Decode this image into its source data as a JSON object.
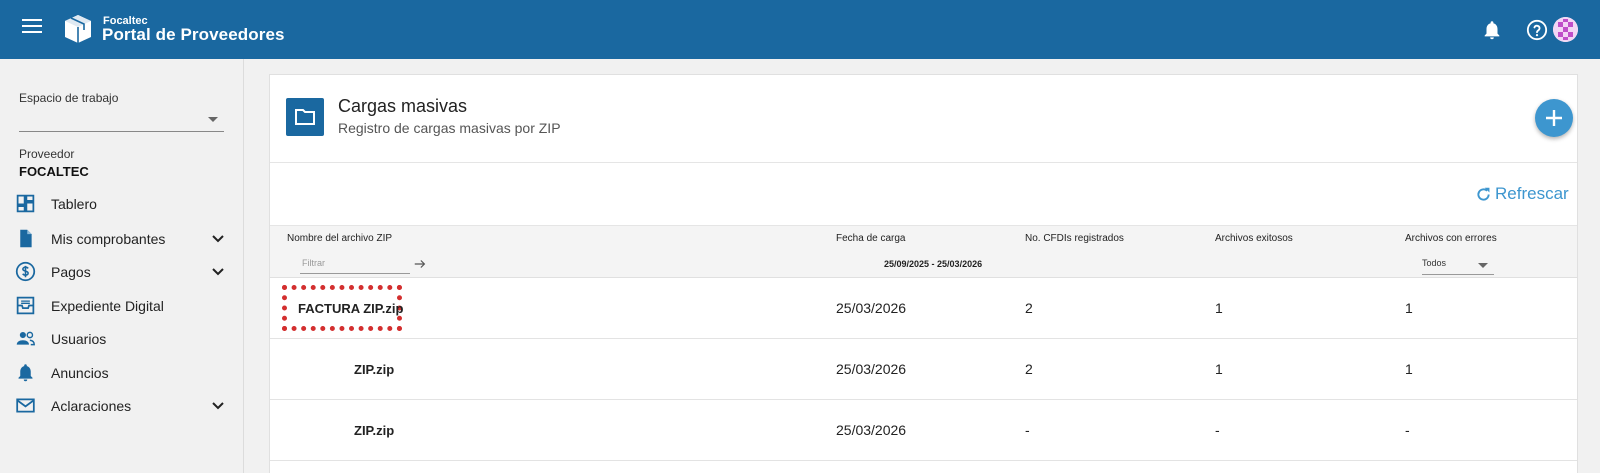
{
  "header": {
    "brand_small": "Focaltec",
    "brand_main": "Portal de Proveedores",
    "colors": {
      "primary": "#1a68a0",
      "accent": "#3d96cf"
    },
    "icons": [
      "menu-icon",
      "cube-logo-icon",
      "bell-icon",
      "help-icon",
      "avatar"
    ]
  },
  "sidebar": {
    "workspace_label": "Espacio de trabajo",
    "workspace_value": "",
    "provider_label": "Proveedor",
    "provider_value": "FOCALTEC",
    "items": [
      {
        "label": "Tablero",
        "icon": "dashboard-icon",
        "expandable": false
      },
      {
        "label": "Mis comprobantes",
        "icon": "document-icon",
        "expandable": true
      },
      {
        "label": "Pagos",
        "icon": "dollar-circle-icon",
        "expandable": true
      },
      {
        "label": "Expediente Digital",
        "icon": "inbox-tray-icon",
        "expandable": false
      },
      {
        "label": "Usuarios",
        "icon": "users-icon",
        "expandable": false
      },
      {
        "label": "Anuncios",
        "icon": "bell-icon",
        "expandable": false
      },
      {
        "label": "Aclaraciones",
        "icon": "mail-icon",
        "expandable": true
      }
    ]
  },
  "main": {
    "title": "Cargas masivas",
    "subtitle": "Registro de cargas masivas por ZIP",
    "refresh_label": "Refrescar",
    "table": {
      "columns": [
        "Nombre del archivo ZIP",
        "Fecha de carga",
        "No. CFDIs registrados",
        "Archivos exitosos",
        "Archivos con errores"
      ],
      "filter_placeholder": "Filtrar",
      "date_range": "25/09/2025 - 25/03/2026",
      "status_filter": "Todos",
      "rows": [
        {
          "name": "FACTURA ZIP.zip",
          "date": "25/03/2026",
          "cfdis": "2",
          "ok": "1",
          "errors": "1"
        },
        {
          "name": "ZIP.zip",
          "date": "25/03/2026",
          "cfdis": "2",
          "ok": "1",
          "errors": "1"
        },
        {
          "name": "ZIP.zip",
          "date": "25/03/2026",
          "cfdis": "-",
          "ok": "-",
          "errors": "-"
        }
      ]
    }
  }
}
